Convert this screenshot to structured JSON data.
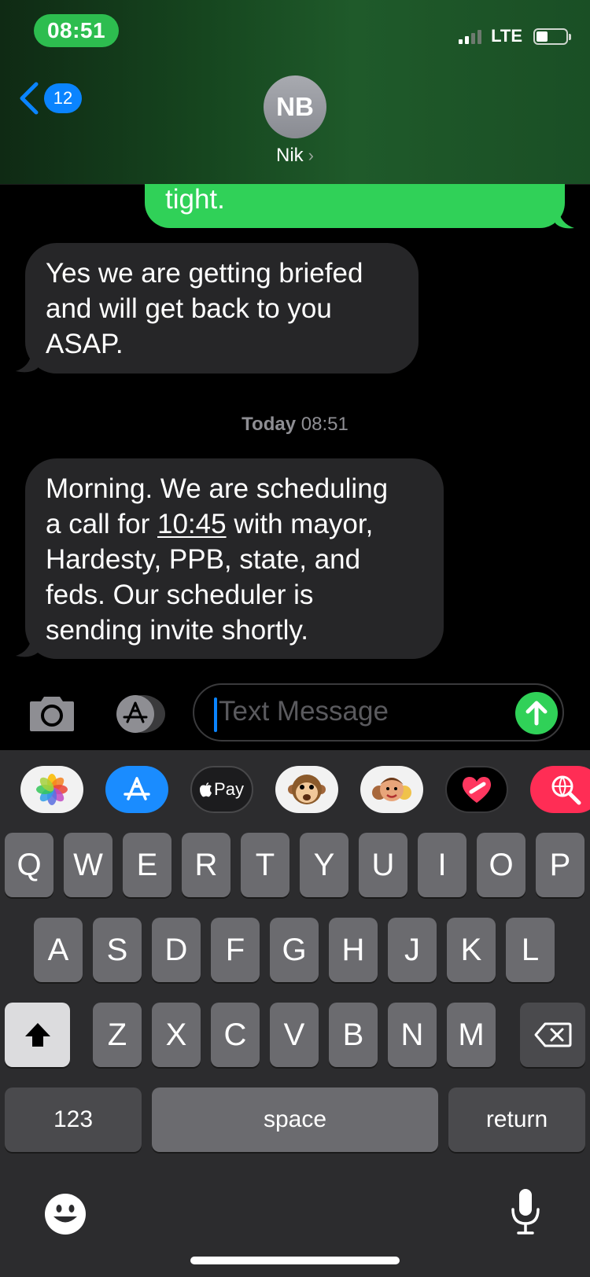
{
  "status_bar": {
    "time": "08:51",
    "network": "LTE"
  },
  "header": {
    "back_count": "12",
    "avatar_initials": "NB",
    "contact_name": "Nik",
    "contact_chevron": "›"
  },
  "conversation": {
    "sent_partial": "tight.",
    "received_1": "Yes we are getting briefed and will get back to you ASAP.",
    "timestamp_day": "Today",
    "timestamp_time": "08:51",
    "received_2": {
      "line1": "Morning. We are scheduling",
      "line2_before": "a call for ",
      "line2_time": "10:45",
      "line2_after": " with mayor,",
      "line3": "Hardesty, PPB, state, and",
      "line4": "feds. Our scheduler is",
      "line5": "sending invite shortly."
    }
  },
  "composer": {
    "placeholder": "Text Message"
  },
  "app_drawer": [
    "photos-app",
    "app-store-app",
    "apple-pay-app",
    "animoji-app",
    "memoji-app",
    "digital-touch-app",
    "images-search-app"
  ],
  "apple_pay_label": "Pay",
  "keyboard": {
    "row1": [
      "Q",
      "W",
      "E",
      "R",
      "T",
      "Y",
      "U",
      "I",
      "O",
      "P"
    ],
    "row2": [
      "A",
      "S",
      "D",
      "F",
      "G",
      "H",
      "J",
      "K",
      "L"
    ],
    "row3": [
      "Z",
      "X",
      "C",
      "V",
      "B",
      "N",
      "M"
    ],
    "numbers_label": "123",
    "space_label": "space",
    "return_label": "return"
  },
  "colors": {
    "sent_bubble": "#30d158",
    "received_bubble": "#262628",
    "accent_blue": "#0a84ff"
  }
}
